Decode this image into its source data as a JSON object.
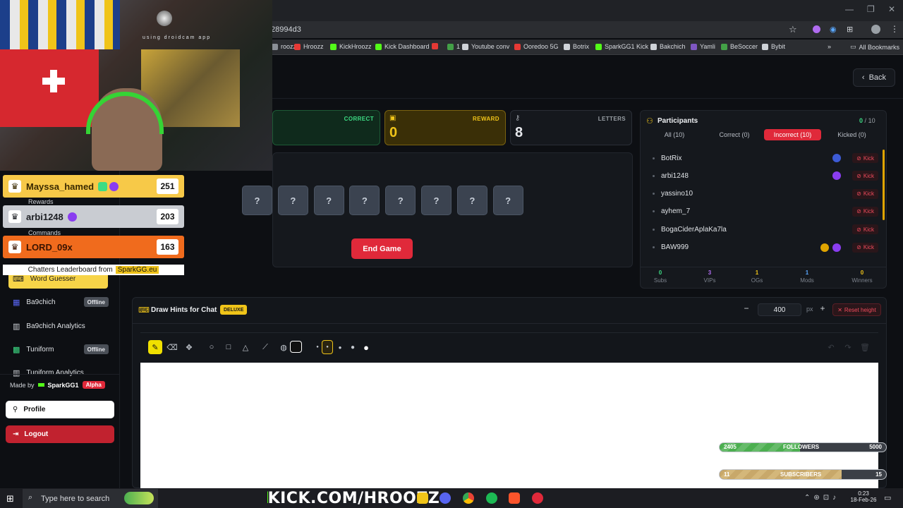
{
  "browser": {
    "address": "28994d3",
    "bookmarks": [
      {
        "label": "roozz",
        "color": "#8a8f96"
      },
      {
        "label": "Hroozz",
        "color": "#e53935"
      },
      {
        "label": "KickHroozz",
        "color": "#53fc18"
      },
      {
        "label": "Kick Dashboard",
        "color": "#53fc18"
      },
      {
        "label": "",
        "color": "#e53935"
      },
      {
        "label": "1",
        "color": "#43a047"
      },
      {
        "label": "Youtube conv",
        "color": "#cfd3d8"
      },
      {
        "label": "Ooredoo 5G",
        "color": "#e53935"
      },
      {
        "label": "Botrix",
        "color": "#cfd3d8"
      },
      {
        "label": "SparkGG1 Kick",
        "color": "#53fc18"
      },
      {
        "label": "Bakchich",
        "color": "#cfd3d8"
      },
      {
        "label": "Yamli",
        "color": "#7e57c2"
      },
      {
        "label": "BeSoccer",
        "color": "#43a047"
      },
      {
        "label": "Bybit",
        "color": "#cfd3d8"
      }
    ],
    "all_bookmarks": "All Bookmarks"
  },
  "header": {
    "back_label": "Back"
  },
  "stats": {
    "correct_label": "CORRECT",
    "reward_label": "REWARD",
    "reward_value": "0",
    "letters_label": "LETTERS",
    "letters_value": "8"
  },
  "game": {
    "tiles": [
      "?",
      "?",
      "?",
      "?",
      "?",
      "?",
      "?",
      "?"
    ],
    "end_button": "End Game"
  },
  "participants": {
    "title": "Participants",
    "count_current": "0",
    "count_sep": "/",
    "count_total": "10",
    "tabs": [
      "All (10)",
      "Correct (0)",
      "Incorrect (10)",
      "Kicked (0)"
    ],
    "kick_label": "Kick",
    "rows": [
      {
        "name": "BotRix"
      },
      {
        "name": "arbi1248"
      },
      {
        "name": "yassino10"
      },
      {
        "name": "ayhem_7"
      },
      {
        "name": "BogaCiderAplaKa7la"
      },
      {
        "name": "BAW999"
      }
    ],
    "summary": [
      {
        "value": "0",
        "label": "Subs",
        "color": "#3ddc84"
      },
      {
        "value": "3",
        "label": "VIPs",
        "color": "#b06cf0"
      },
      {
        "value": "1",
        "label": "OGs",
        "color": "#f0c419"
      },
      {
        "value": "1",
        "label": "Mods",
        "color": "#5aa8ff"
      },
      {
        "value": "0",
        "label": "Winners",
        "color": "#f0c419"
      }
    ]
  },
  "draw": {
    "title": "Draw Hints for Chat",
    "badge": "DELUXE",
    "height_value": "400",
    "height_unit": "px",
    "reset_label": "Reset height"
  },
  "sidebar": {
    "items": [
      {
        "label": "Word Guesser",
        "active": true
      },
      {
        "label": "Ba9chich",
        "status": "Offline"
      },
      {
        "label": "Ba9chich Analytics"
      },
      {
        "label": "Tuniform",
        "status": "Offline"
      },
      {
        "label": "Tuniform Analytics"
      }
    ],
    "made_by": "Made by",
    "maker": "SparkGG1",
    "maker_badge": "Alpha",
    "profile": "Profile",
    "logout": "Logout"
  },
  "overlay": {
    "leaderboard": [
      {
        "name": "Mayssa_hamed",
        "score": "251",
        "bg": "#f7c948",
        "fg": "#3a2a00"
      },
      {
        "name": "arbi1248",
        "score": "203",
        "bg": "#c9ccd2",
        "fg": "#1d1f24"
      },
      {
        "name": "LORD_09x",
        "score": "163",
        "bg": "#f06b1d",
        "fg": "#3a1400"
      }
    ],
    "footer_text": "Chatters Leaderboard from",
    "footer_brand": "SparkGG.eu",
    "webcam_caption": "using droidcam app",
    "behind_labels": [
      "Rewards",
      "Commands"
    ],
    "followers": {
      "label": "FOLLOWERS",
      "current": "2405",
      "goal": "5000",
      "fraction": 0.481
    },
    "subscribers": {
      "label": "SUBSCRIBERS",
      "current": "11",
      "goal": "15",
      "fraction": 0.733
    }
  },
  "taskbar": {
    "search_placeholder": "Type here to search",
    "brand": "KICK.COM/HROOZZ",
    "time": "0:23",
    "date": "18-Feb-26"
  }
}
